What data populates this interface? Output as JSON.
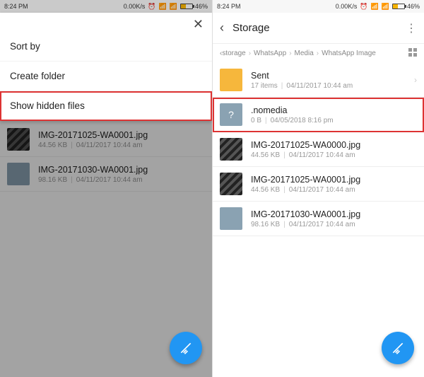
{
  "status": {
    "time": "8:24 PM",
    "speed": "0.00K/s",
    "battery": "46%"
  },
  "left": {
    "menu": {
      "sort": "Sort by",
      "create_folder": "Create folder",
      "show_hidden": "Show hidden files"
    },
    "files": [
      {
        "name": "IMG-20171025-WA0001.jpg",
        "size": "44.56 KB",
        "date": "04/11/2017 10:44 am"
      },
      {
        "name": "IMG-20171030-WA0001.jpg",
        "size": "98.16 KB",
        "date": "04/11/2017 10:44 am"
      }
    ]
  },
  "right": {
    "title": "Storage",
    "crumbs": [
      "storage",
      "WhatsApp",
      "Media",
      "WhatsApp Image"
    ],
    "items": [
      {
        "name": "Sent",
        "size": "17 items",
        "date": "04/11/2017 10:44 am",
        "type": "folder"
      },
      {
        "name": ".nomedia",
        "size": "0 B",
        "date": "04/05/2018 8:16 pm",
        "type": "unknown",
        "hl": true
      },
      {
        "name": "IMG-20171025-WA0000.jpg",
        "size": "44.56 KB",
        "date": "04/11/2017 10:44 am",
        "type": "img-book"
      },
      {
        "name": "IMG-20171025-WA0001.jpg",
        "size": "44.56 KB",
        "date": "04/11/2017 10:44 am",
        "type": "img-book"
      },
      {
        "name": "IMG-20171030-WA0001.jpg",
        "size": "98.16 KB",
        "date": "04/11/2017 10:44 am",
        "type": "img-pale"
      }
    ]
  }
}
